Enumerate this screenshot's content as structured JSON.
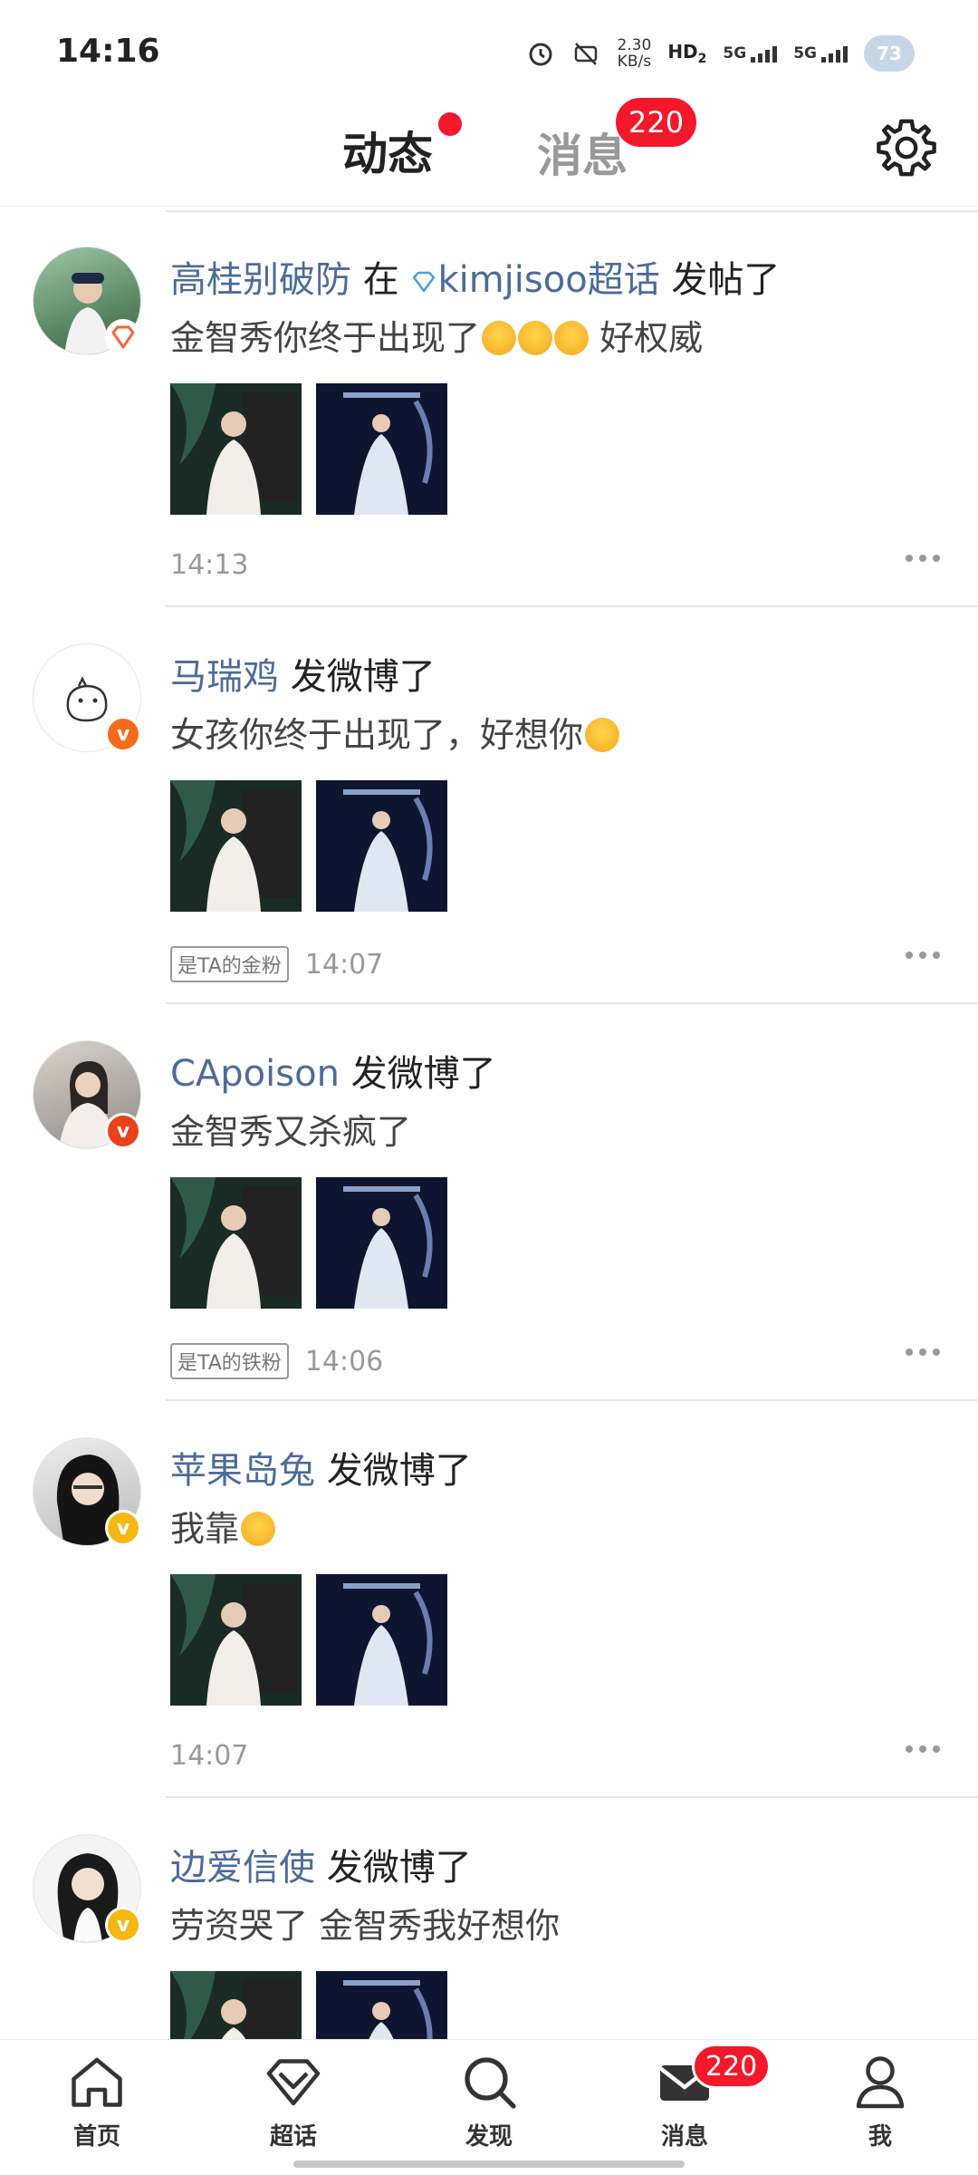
{
  "status_bar": {
    "time": "14:16",
    "net_speed_value": "2.30",
    "net_speed_unit": "KB/s",
    "hd_label": "HD",
    "hd_sub": "2",
    "sim1_label": "5G",
    "sim2_label": "5G",
    "battery_level": "73"
  },
  "header": {
    "active_tab": "动态",
    "messages_tab": "消息",
    "messages_badge": "220"
  },
  "feed": [
    {
      "username": "高桂别破防",
      "action_prefix": "在",
      "topic": "kimjisoo超话",
      "action": "发帖了",
      "text": "金智秀你终于出现了",
      "text_suffix": "好权威",
      "emoji_count": 3,
      "badge_type": "diamond",
      "fan_tag": "",
      "time": "14:13",
      "thumbs": [
        "post-photo-1",
        "post-photo-2"
      ]
    },
    {
      "username": "马瑞鸡",
      "action": "发微博了",
      "text": "女孩你终于出现了，好想你",
      "emoji_count": 1,
      "badge_type": "orange",
      "fan_tag": "是TA的金粉",
      "time": "14:07",
      "thumbs": [
        "post-photo-1",
        "post-photo-2"
      ]
    },
    {
      "username": "CApoison",
      "action": "发微博了",
      "text": "金智秀又杀疯了",
      "emoji_count": 0,
      "badge_type": "red",
      "fan_tag": "是TA的铁粉",
      "time": "14:06",
      "thumbs": [
        "post-photo-1",
        "post-photo-2"
      ]
    },
    {
      "username": "苹果岛兔",
      "action": "发微博了",
      "text": "我靠",
      "emoji_count": 1,
      "badge_type": "gold",
      "fan_tag": "",
      "time": "14:07",
      "thumbs": [
        "post-photo-1",
        "post-photo-2"
      ]
    },
    {
      "username": "边爱信使",
      "action": "发微博了",
      "text": "劳资哭了 金智秀我好想你",
      "emoji_count": 0,
      "badge_type": "gold",
      "fan_tag": "",
      "time": "",
      "thumbs": [
        "post-photo-1",
        "post-photo-2"
      ]
    }
  ],
  "bottom_nav": {
    "home": "首页",
    "super_topic": "超话",
    "discover": "发现",
    "messages": "消息",
    "messages_badge": "220",
    "me": "我"
  },
  "icons": {
    "settings": "gear-icon",
    "home": "home-icon",
    "super_topic": "diamond-icon",
    "discover": "search-icon",
    "messages": "envelope-icon",
    "me": "person-icon"
  },
  "colors": {
    "accent": "#f5a623",
    "badge_red": "#f3182a",
    "username_blue": "#4c6b9a"
  }
}
